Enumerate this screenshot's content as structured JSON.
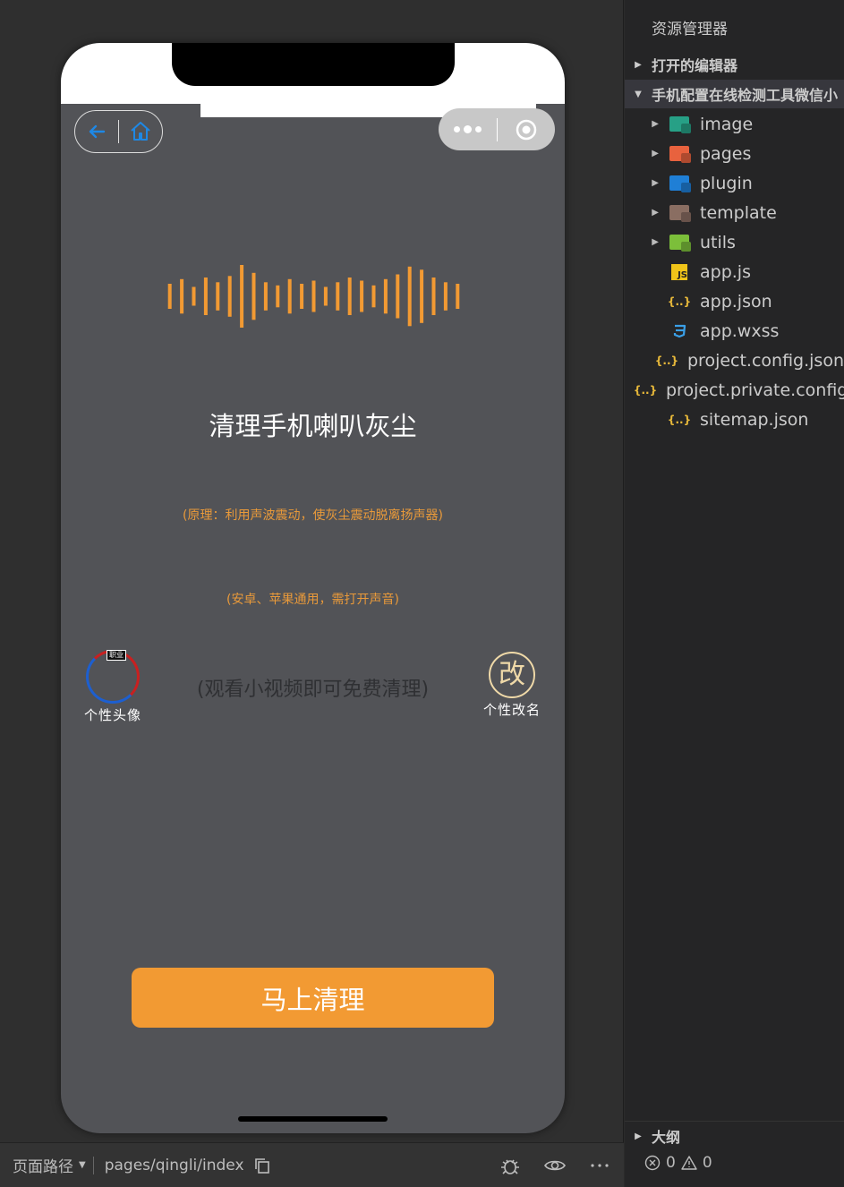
{
  "simulator": {
    "page_title": "清理手机喇叭灰尘",
    "principle": "(原理：利用声波震动，使灰尘震动脱离扬声器)",
    "compat": "(安卓、苹果通用，需打开声音)",
    "watch_hint": "(观看小视频即可免费清理)",
    "avatar_badge": "职业",
    "avatar_label": "个性头像",
    "rename_glyph": "改",
    "rename_label": "个性改名",
    "clean_button": "马上清理",
    "wave_heights": [
      0.4,
      0.55,
      0.3,
      0.6,
      0.45,
      0.65,
      1.0,
      0.75,
      0.45,
      0.35,
      0.55,
      0.4,
      0.5,
      0.3,
      0.45,
      0.6,
      0.5,
      0.35,
      0.55,
      0.7,
      0.95,
      0.85,
      0.6,
      0.45,
      0.4
    ],
    "accent_color": "#f29a33"
  },
  "status_bar": {
    "path_label": "页面路径",
    "path": "pages/qingli/index"
  },
  "explorer": {
    "title": "资源管理器",
    "open_editors": "打开的编辑器",
    "project": "手机配置在线检测工具微信小",
    "items": [
      {
        "name": "image",
        "type": "folder",
        "color": "#27a086"
      },
      {
        "name": "pages",
        "type": "folder",
        "color": "#e8623e"
      },
      {
        "name": "plugin",
        "type": "folder",
        "color": "#1f7fd6"
      },
      {
        "name": "template",
        "type": "folder",
        "color": "#8a6e62"
      },
      {
        "name": "utils",
        "type": "folder",
        "color": "#7cbf3a"
      },
      {
        "name": "app.js",
        "type": "js"
      },
      {
        "name": "app.json",
        "type": "json"
      },
      {
        "name": "app.wxss",
        "type": "css"
      },
      {
        "name": "project.config.json",
        "type": "json"
      },
      {
        "name": "project.private.config.json",
        "type": "json"
      },
      {
        "name": "sitemap.json",
        "type": "json"
      }
    ],
    "outline": "大纲",
    "errors": "0",
    "warnings": "0"
  }
}
